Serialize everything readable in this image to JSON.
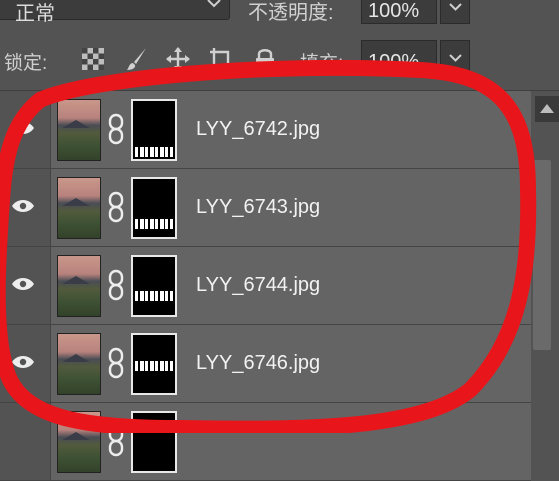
{
  "toolbar": {
    "blend_mode": "正常",
    "opacity_label": "不透明度:",
    "opacity_value": "100%",
    "lock_label": "锁定:",
    "fill_label": "填充:",
    "fill_value": "100%",
    "lock_icons": [
      "lock-transparent-pixels-icon",
      "lock-image-pixels-icon",
      "lock-position-icon",
      "lock-artboard-icon",
      "lock-all-icon"
    ]
  },
  "layers": [
    {
      "name": "LYY_6742.jpg",
      "visible": true
    },
    {
      "name": "LYY_6743.jpg",
      "visible": true
    },
    {
      "name": "LYY_6744.jpg",
      "visible": true
    },
    {
      "name": "LYY_6746.jpg",
      "visible": true
    },
    {
      "name": "",
      "visible": true
    }
  ],
  "colors": {
    "panel_bg": "#535353",
    "layer_bg": "#646464",
    "annotation_red": "#e8161b"
  }
}
